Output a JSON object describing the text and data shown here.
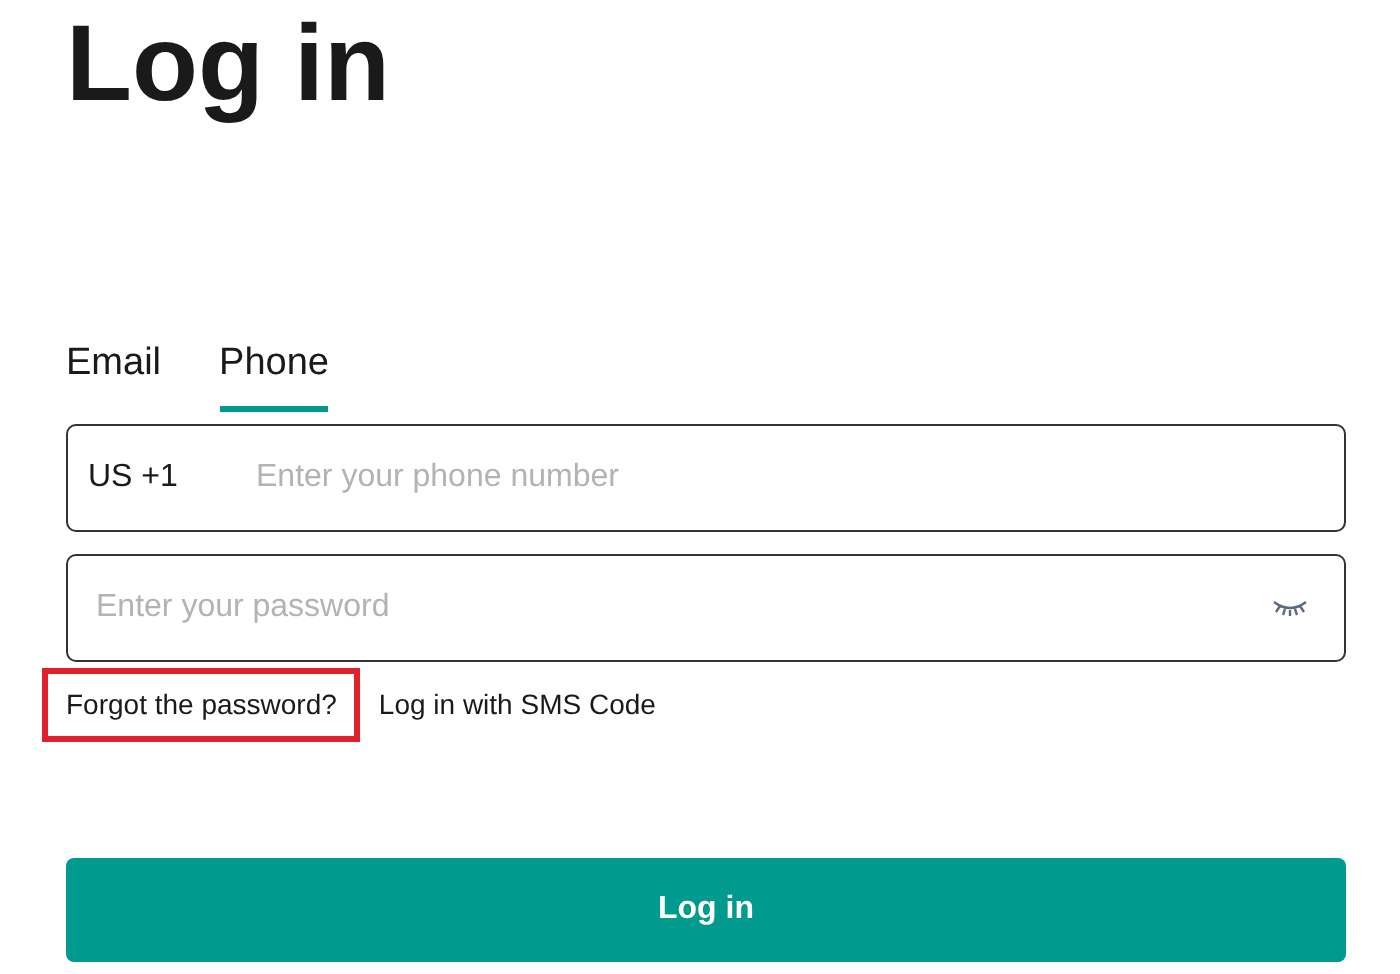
{
  "title": "Log in",
  "tabs": [
    {
      "label": "Email",
      "selected": false
    },
    {
      "label": "Phone",
      "selected": true
    }
  ],
  "phone_field": {
    "country_code": "US +1",
    "placeholder": "Enter your phone number"
  },
  "password_field": {
    "placeholder": "Enter your password"
  },
  "links": [
    {
      "label": "Forgot the password?",
      "highlighted": true
    },
    {
      "label": "Log in with SMS Code",
      "highlighted": false
    }
  ],
  "submit_button": "Log in"
}
